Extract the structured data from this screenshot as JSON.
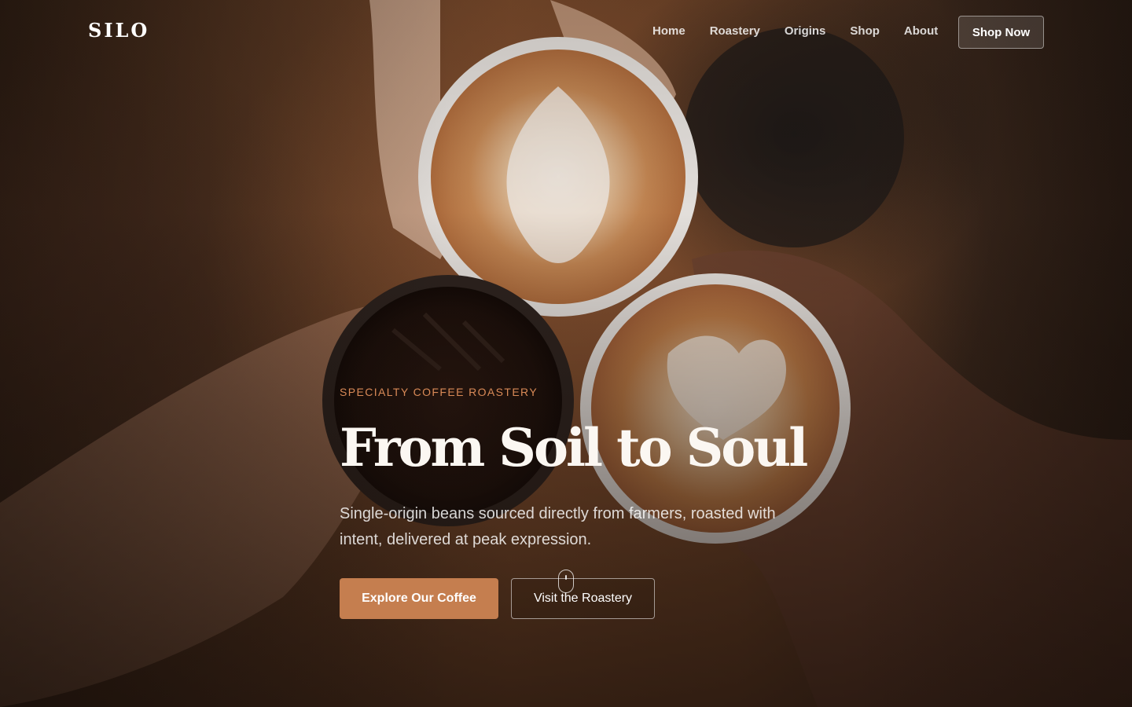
{
  "brand": {
    "logo_text": "SILO",
    "accent_color": "#c57e4f",
    "eyebrow_color": "#d98a57"
  },
  "nav": {
    "links": [
      {
        "label": "Home"
      },
      {
        "label": "Roastery"
      },
      {
        "label": "Origins"
      },
      {
        "label": "Shop"
      },
      {
        "label": "About"
      }
    ],
    "cta_label": "Shop Now"
  },
  "hero": {
    "eyebrow": "SPECIALTY COFFEE ROASTERY",
    "headline": "From Soil to Soul",
    "subtitle": "Single-origin beans sourced directly from farmers, roasted with intent, delivered at peak expression.",
    "primary_button": "Explore Our Coffee",
    "secondary_button": "Visit the Roastery",
    "scroll_icon": "mouse-scroll-icon",
    "background_image": "hands-toasting-coffee-cups-photo"
  }
}
